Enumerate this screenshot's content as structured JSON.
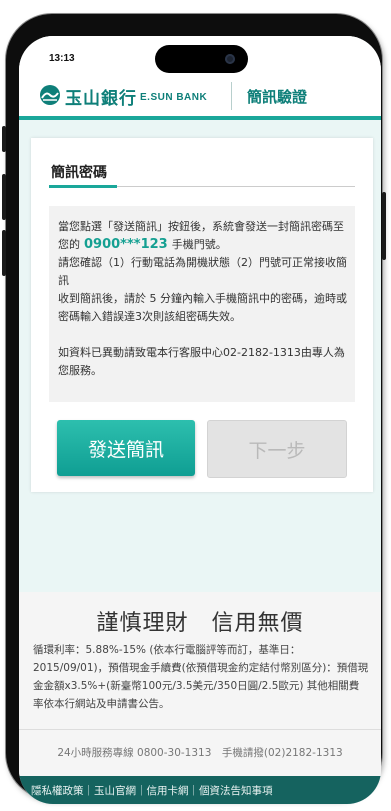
{
  "status_bar": {
    "time": "13:13"
  },
  "header": {
    "bank_name_cn": "玉山銀行",
    "bank_name_en": "E.SUN BANK",
    "page_title": "簡訊驗證"
  },
  "card": {
    "title": "簡訊密碼",
    "info_line1_before": "當您點選「發送簡訊」按鈕後，系統會發送一封簡訊密碼至您的",
    "phone_number": "0900***123",
    "info_line1_after": "手機門號。",
    "info_line2": "請您確認（1）行動電話為開機狀態（2）門號可正常接收簡訊",
    "info_line3": "收到簡訊後，請於 5 分鐘內輸入手機簡訊中的密碼，逾時或密碼輸入錯誤達3次則該組密碼失效。",
    "info_line4": "如資料已異動請致電本行客服中心02-2182-1313由專人為您服務。"
  },
  "buttons": {
    "send_label": "發送簡訊",
    "next_label": "下一步"
  },
  "promo": {
    "slogan": "謹慎理財　信用無價",
    "disclaimer": "循環利率：5.88%-15% (依本行電腦評等而訂，基準日：2015/09/01)，預借現金手續費(依預借現金約定結付幣別區分)：預借現金金額x3.5%+(新臺幣100元/3.5美元/350日圓/2.5歐元) 其他相關費率依本行網站及申請書公告。"
  },
  "footer": {
    "service_text": "24小時服務專線 0800-30-1313　手機請撥(02)2182-1313"
  },
  "bottom_bar": {
    "text": "隱私權政策｜玉山官網｜信用卡網｜個資法告知事項"
  },
  "colors": {
    "brand": "#1aa79a",
    "brand_dark": "#0e7f79",
    "disabled": "#e3e3e3"
  },
  "icons": {
    "logo": "esun-logo-icon"
  }
}
